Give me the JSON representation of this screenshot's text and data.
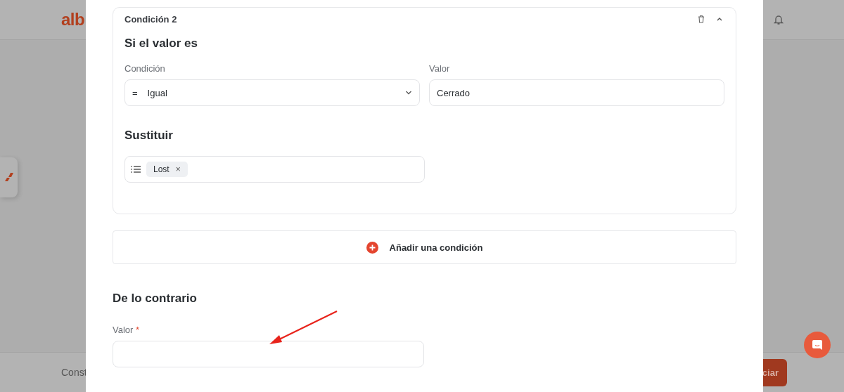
{
  "backdrop": {
    "logo": "alb",
    "footer_text": "Const",
    "footer_button": "ciar"
  },
  "modal": {
    "condition_card": {
      "title": "Condición 2",
      "expanded": true,
      "if_heading": "Si el valor es",
      "condition_label": "Condición",
      "condition_symbol": "=",
      "condition_value": "Igual",
      "value_label": "Valor",
      "value": "Cerrado",
      "replace_heading": "Sustituir",
      "tags": [
        {
          "label": "Lost",
          "remove": "×"
        }
      ]
    },
    "add_condition": "Añadir una condición",
    "otherwise": {
      "heading": "De lo contrario",
      "label": "Valor",
      "required": true,
      "required_mark": "*"
    }
  }
}
